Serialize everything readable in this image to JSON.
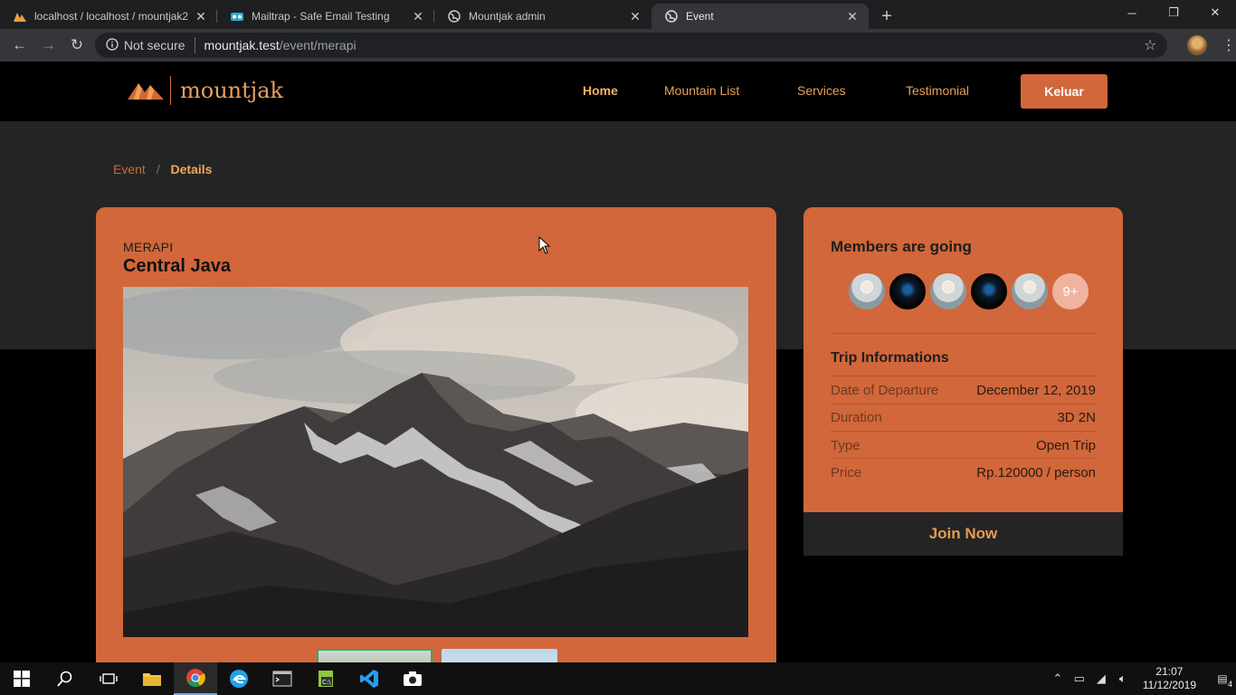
{
  "browser": {
    "tabs": [
      {
        "label": "localhost / localhost / mountjak2",
        "icon": "phpmyadmin-icon"
      },
      {
        "label": "Mailtrap - Safe Email Testing",
        "icon": "mailtrap-icon"
      },
      {
        "label": "Mountjak admin",
        "icon": "globe-icon"
      },
      {
        "label": "Event",
        "icon": "globe-icon"
      }
    ],
    "security_label": "Not secure",
    "url_host": "mountjak.test",
    "url_path": "/event/merapi"
  },
  "site": {
    "brand": "mountjak",
    "nav": {
      "home": "Home",
      "mountain_list": "Mountain List",
      "services": "Services",
      "testimonial": "Testimonial"
    },
    "logout_label": "Keluar"
  },
  "breadcrumb": {
    "parent": "Event",
    "current": "Details"
  },
  "event": {
    "mountain": "MERAPI",
    "location": "Central Java"
  },
  "members": {
    "heading": "Members are going",
    "avatars": [
      "light",
      "dark",
      "light",
      "dark",
      "light"
    ],
    "more": "9+"
  },
  "trip": {
    "heading": "Trip Informations",
    "rows": [
      {
        "label": "Date of Departure",
        "value": "December 12, 2019"
      },
      {
        "label": "Duration",
        "value": "3D 2N"
      },
      {
        "label": "Type",
        "value": "Open Trip"
      },
      {
        "label": "Price",
        "value": "Rp.120000 / person"
      }
    ],
    "cta": "Join Now"
  },
  "taskbar": {
    "time": "21:07",
    "date": "11/12/2019",
    "notifications": "4"
  },
  "colors": {
    "accent": "#d1673a",
    "nav_text": "#e6a05a",
    "dark_panel": "#242424"
  }
}
